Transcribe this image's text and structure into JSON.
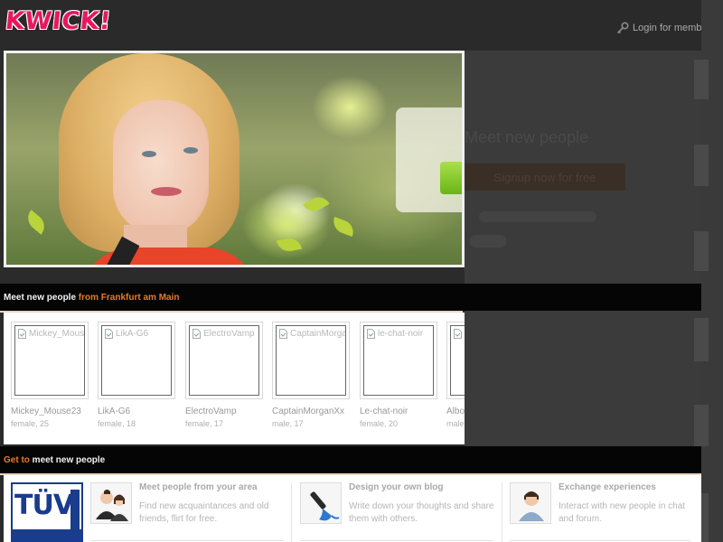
{
  "header": {
    "logo": "KWICK!",
    "login_label": "Login for memb"
  },
  "hero": {
    "headline": "Meet new people",
    "signup_label": "Signup now for free"
  },
  "people_section": {
    "title_white": "Meet new people",
    "title_orange": "from Frankfurt am Main",
    "people": [
      {
        "alt": "Mickey_Mous",
        "name": "Mickey_Mouse23",
        "meta": "female, 25"
      },
      {
        "alt": "LikA-G6",
        "name": "LikA-G6",
        "meta": "female, 18"
      },
      {
        "alt": "ElectroVamp",
        "name": "ElectroVamp",
        "meta": "female, 17"
      },
      {
        "alt": "CaptainMorga",
        "name": "CaptainMorganXx",
        "meta": "male, 17"
      },
      {
        "alt": "le-chat-noir",
        "name": "Le-chat-noir",
        "meta": "female, 20"
      },
      {
        "alt": "",
        "name": "Albo",
        "meta": "male"
      }
    ]
  },
  "features_section": {
    "title_orange": "Get to",
    "title_white": "meet new people",
    "tuv_label": "TÜV",
    "items": [
      {
        "title": "Meet people from your area",
        "desc": "Find new acquaintances and old friends, flirt for free.",
        "icon": "people-icon"
      },
      {
        "title": "Design your own blog",
        "desc": "Write down your thoughts and share them with others.",
        "icon": "paintbrush-icon"
      },
      {
        "title": "Exchange experiences",
        "desc": "Interact with new people in chat and forum.",
        "icon": "person-icon"
      }
    ]
  },
  "colors": {
    "logo": "#e5195f",
    "accent_orange": "#e87a2c",
    "button_green": "#69b517"
  }
}
